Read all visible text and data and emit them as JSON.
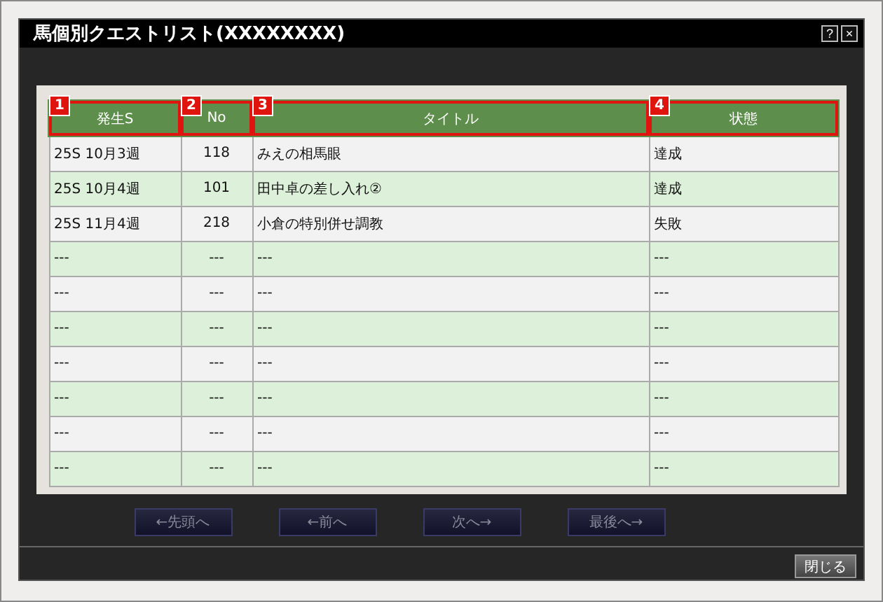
{
  "window": {
    "title": "馬個別クエストリスト(XXXXXXXX)",
    "help_button": "?",
    "close_icon": "×"
  },
  "table": {
    "columns": [
      {
        "label": "発生S",
        "badge": "1",
        "highlighted": true
      },
      {
        "label": "No",
        "badge": "2",
        "highlighted": true
      },
      {
        "label": "タイトル",
        "badge": "3",
        "highlighted": true
      },
      {
        "label": "状態",
        "badge": "4",
        "highlighted": true
      }
    ],
    "rows": [
      [
        "25S 10月3週",
        "118",
        "みえの相馬眼",
        "達成"
      ],
      [
        "25S 10月4週",
        "101",
        "田中卓の差し入れ②",
        "達成"
      ],
      [
        "25S 11月4週",
        "218",
        "小倉の特別併せ調教",
        "失敗"
      ],
      [
        "---",
        "---",
        "---",
        "---"
      ],
      [
        "---",
        "---",
        "---",
        "---"
      ],
      [
        "---",
        "---",
        "---",
        "---"
      ],
      [
        "---",
        "---",
        "---",
        "---"
      ],
      [
        "---",
        "---",
        "---",
        "---"
      ],
      [
        "---",
        "---",
        "---",
        "---"
      ],
      [
        "---",
        "---",
        "---",
        "---"
      ]
    ]
  },
  "pager": [
    {
      "label": "←先頭へ",
      "disabled": true
    },
    {
      "label": "←前へ",
      "disabled": true
    },
    {
      "label": "次へ→",
      "disabled": true
    },
    {
      "label": "最後へ→",
      "disabled": true
    }
  ],
  "close_button": "閉じる"
}
